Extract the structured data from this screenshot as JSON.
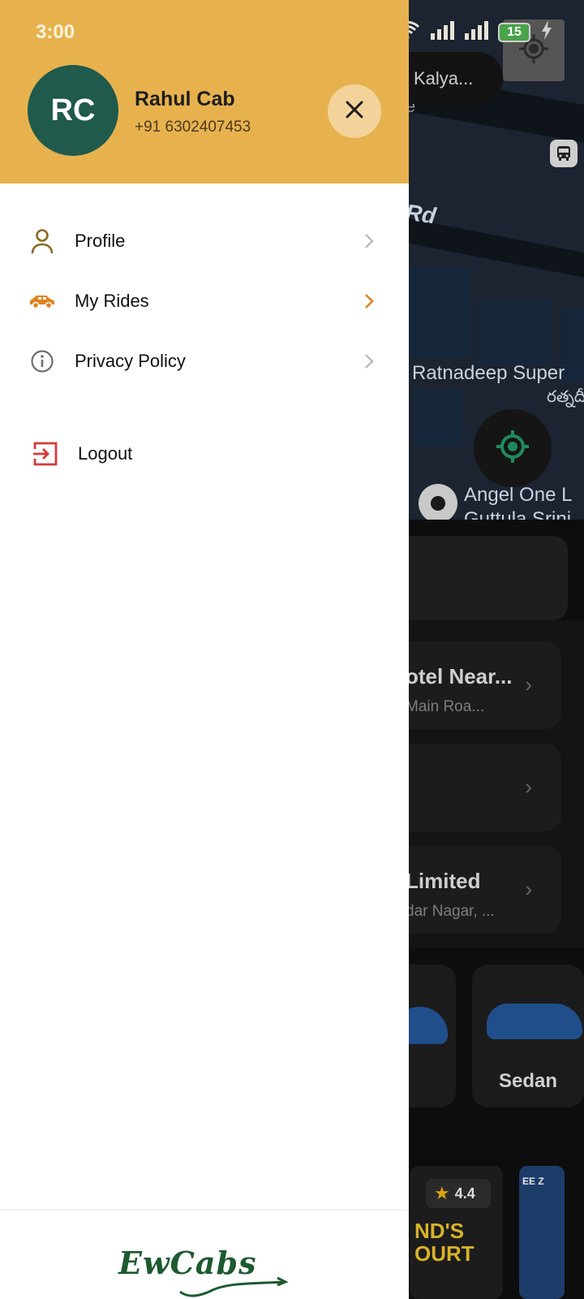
{
  "status_bar": {
    "time": "3:00",
    "battery": "15"
  },
  "drawer": {
    "avatar_initials": "RC",
    "user_name": "Rahul Cab",
    "user_phone": "+91 6302407453",
    "menu_items": [
      {
        "label": "Profile",
        "icon": "person-icon",
        "active": false
      },
      {
        "label": "My Rides",
        "icon": "car-icon",
        "active": true
      },
      {
        "label": "Privacy Policy",
        "icon": "info-icon",
        "active": false
      }
    ],
    "logout_label": "Logout",
    "brand": "EwCabs"
  },
  "background": {
    "search_pill": "Kalya...",
    "map_labels": {
      "road": "Rd",
      "store": "Ratnadeep Super",
      "store_telugu": "రత్నదీ",
      "poi": "Angel One L",
      "poi_line2": "Guttula Srini",
      "road_partial": "e"
    },
    "places": [
      {
        "title": "otel Near...",
        "subtitle": "Main Roa..."
      },
      {
        "title": "",
        "subtitle": ""
      },
      {
        "title": "Limited",
        "subtitle": "dar Nagar, ..."
      }
    ],
    "vehicle_label": "Sedan",
    "promo_rating": "4.4",
    "promo_text": "ND'S\nOURT",
    "promo2_text": "EE Z"
  },
  "colors": {
    "header": "#e7b24e",
    "avatar": "#1f5a4c",
    "active_accent": "#e0821d",
    "logout": "#d63a3a",
    "brand_green": "#1d5a2f"
  }
}
